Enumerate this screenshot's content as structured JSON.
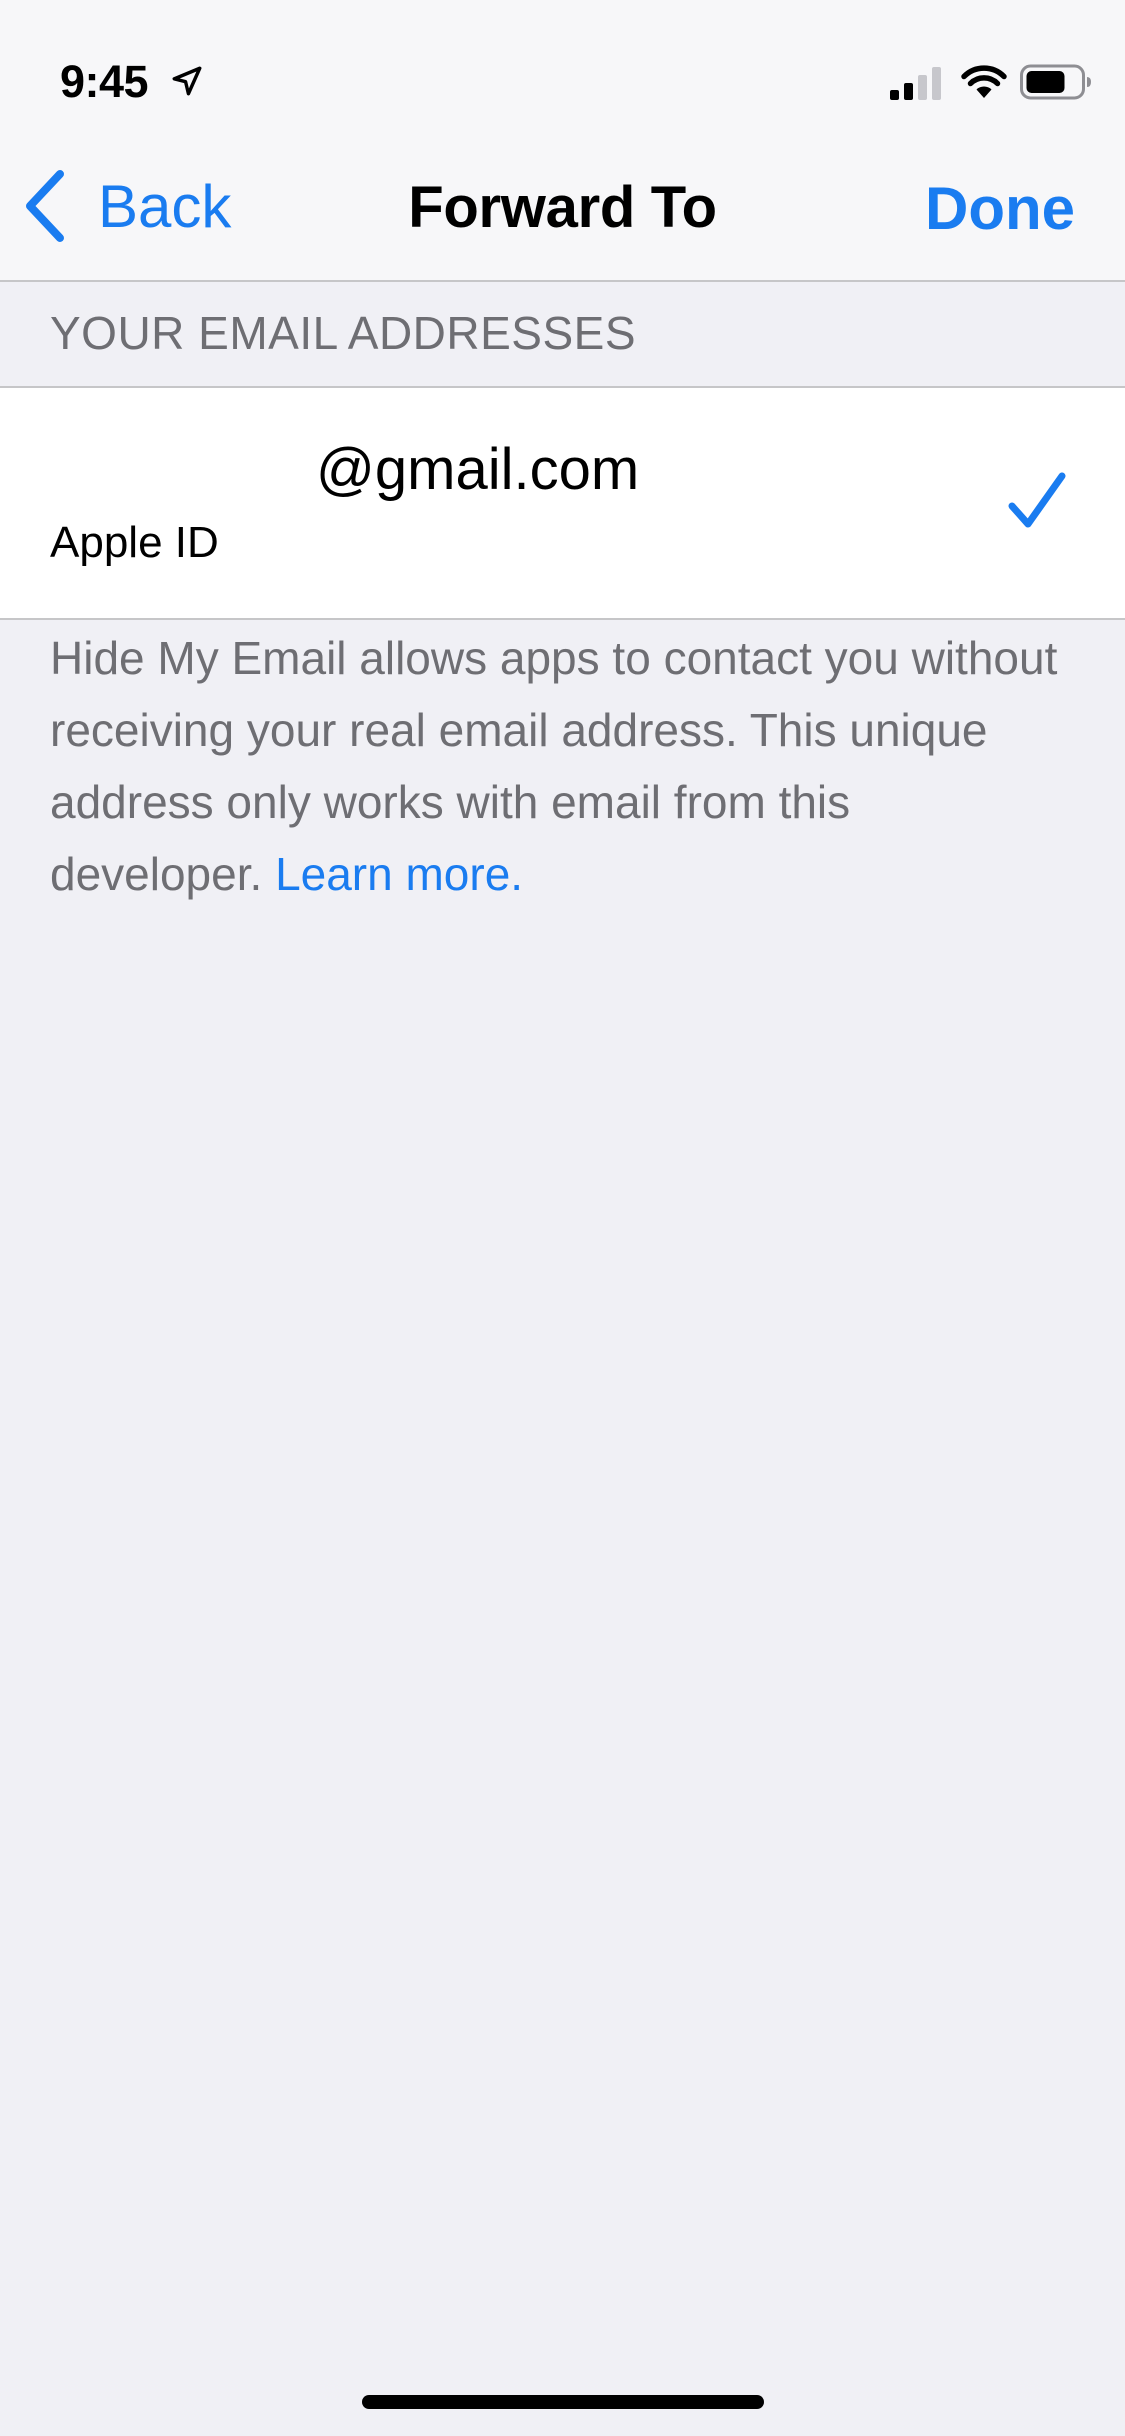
{
  "status_bar": {
    "time": "9:45",
    "icons": [
      "location-arrow-icon",
      "cellular-signal-icon",
      "wifi-icon",
      "battery-icon"
    ]
  },
  "nav": {
    "back_label": "Back",
    "title": "Forward To",
    "done_label": "Done"
  },
  "section": {
    "header": "YOUR EMAIL ADDRESSES",
    "email_cell": {
      "email": "@gmail.com",
      "subtitle": "Apple ID",
      "selected": true
    }
  },
  "footer": {
    "text": "Hide My Email allows apps to contact you without receiving your real email address. This unique address only works with email from this developer. ",
    "link_label": "Learn more."
  },
  "colors": {
    "accent": "#1a7cf0",
    "background": "#f0f0f5",
    "secondary_text": "#6e6e73",
    "separator": "#c6c6c8"
  }
}
